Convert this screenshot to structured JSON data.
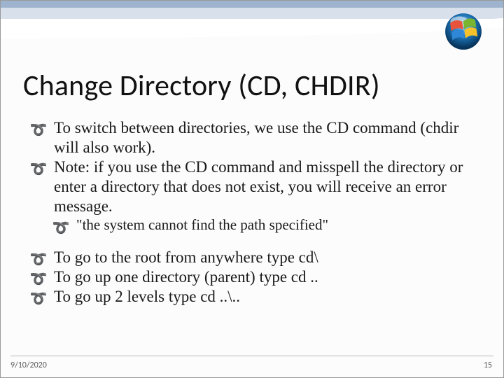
{
  "title": "Change Directory (CD, CHDIR)",
  "bullets": {
    "b1": "To switch between directories, we use the CD command (chdir will also work).",
    "b2": "Note: if you use the CD command and misspell the directory or enter a directory that does not exist, you will receive an error message.",
    "b2a": "\"the system cannot find the path specified\"",
    "b3": "To go to the root from anywhere type cd\\",
    "b4": "To go up one directory (parent) type cd ..",
    "b5": "To go up 2 levels type cd ..\\.."
  },
  "footer": {
    "date": "9/10/2020",
    "page": "15"
  },
  "icon": {
    "name": "windows-vista-logo"
  }
}
